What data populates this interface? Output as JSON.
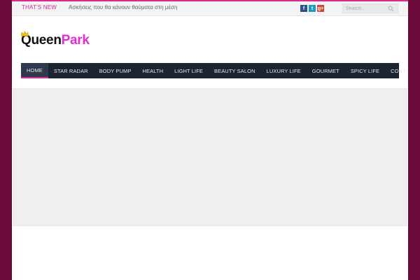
{
  "colors": {
    "accent": "#e3258f",
    "frame": "#6b0a3a",
    "nav_bg": "#1c2431",
    "logo_pink": "#e62bd6"
  },
  "topbar": {
    "label": "THAT'S NEW",
    "ticker": "Ασκήσεις που θα κάνουν θαύματα στη μέση",
    "social": [
      {
        "icon": "facebook-icon",
        "glyph": "f"
      },
      {
        "icon": "twitter-icon",
        "glyph": "t"
      },
      {
        "icon": "google-plus-icon",
        "glyph": "g+"
      }
    ],
    "search_placeholder": "Search..."
  },
  "logo": {
    "part1": "Queen",
    "part2": "Park"
  },
  "nav": [
    {
      "label": "HOME",
      "active": true
    },
    {
      "label": "STAR RADAR"
    },
    {
      "label": "BODY PUMP"
    },
    {
      "label": "HEALTH"
    },
    {
      "label": "LIGHT LIFE"
    },
    {
      "label": "BEAUTY SALON"
    },
    {
      "label": "LUXURY LIFE"
    },
    {
      "label": "GOURMET"
    },
    {
      "label": "SPICY LIFE"
    },
    {
      "label": "CONTACT"
    }
  ]
}
